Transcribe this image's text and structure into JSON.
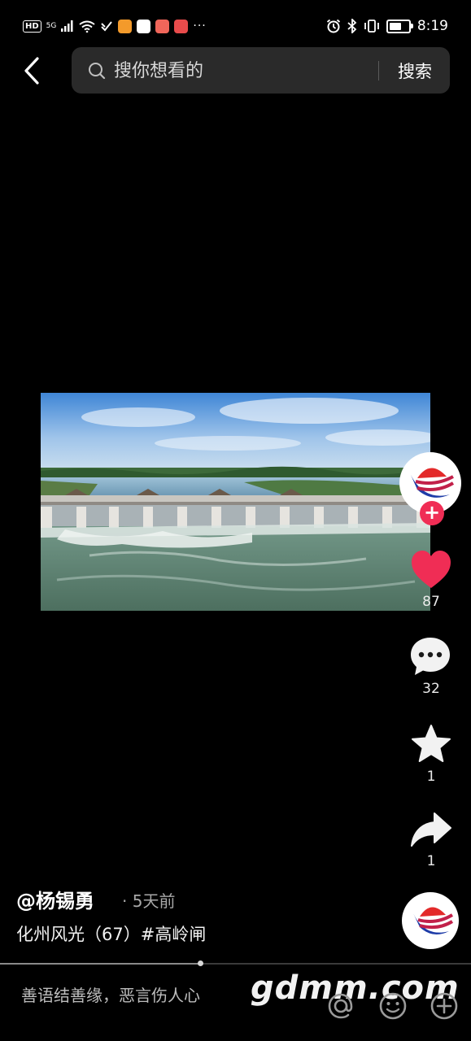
{
  "status_bar": {
    "hd": "HD",
    "network": "5G",
    "time": "8:19",
    "more": "···"
  },
  "search": {
    "placeholder": "搜你想看的",
    "submit_label": "搜索"
  },
  "video": {
    "scene": "aerial-view-river-sluice-gate"
  },
  "actions": {
    "likes": "87",
    "comments": "32",
    "favorites": "1",
    "shares": "1",
    "accent_color": "#f02d55"
  },
  "post": {
    "author": "@杨锡勇",
    "posted": "· 5天前",
    "caption": "化州风光（67）#高岭闸"
  },
  "playback": {
    "progress": 0.425
  },
  "comment_bar": {
    "placeholder": "善语结善缘，恶言伤人心"
  },
  "watermark": "gdmm.com"
}
